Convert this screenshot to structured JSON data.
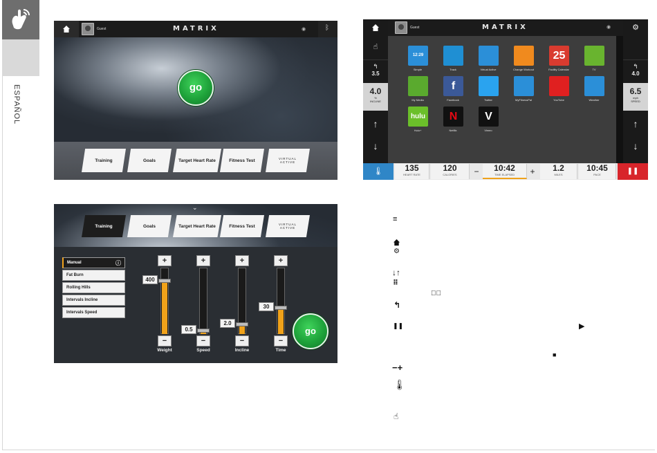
{
  "side": {
    "language": "ESPAÑOL"
  },
  "screen1": {
    "guest": "Guest",
    "logo": "MATRIX",
    "go": "go",
    "menu": [
      "Training",
      "Goals",
      "Target Heart Rate",
      "Fitness Test"
    ],
    "virtual_active_line1": "VIRTUAL",
    "virtual_active_line2": "ACTIVE"
  },
  "screen2": {
    "guest": "Guest",
    "logo": "MATRIX",
    "apps": [
      "Simple",
      "Track",
      "Virtual Active",
      "Change Workout",
      "Facility Calendar",
      "TV",
      "My Media",
      "Facebook",
      "Twitter",
      "MyFitnessPal",
      "YouTube",
      "Weather",
      "Hulu+",
      "Netflix",
      "Vimeo"
    ],
    "app_glyphs": {
      "simple": "12:29",
      "calendar": "25",
      "facebook": "f",
      "hulu": "hulu",
      "netflix": "N",
      "vimeo": "V"
    },
    "left": {
      "back_value": "3.5",
      "incline_value": "4.0",
      "incline_unit": "%",
      "incline_label": "INCLINE"
    },
    "right": {
      "back_value": "4.0",
      "speed_value": "6.5",
      "speed_unit": "mph",
      "speed_label": "SPEED"
    },
    "stats": [
      {
        "value": "135",
        "label": "HEART RATE"
      },
      {
        "value": "120",
        "label": "CALORIES"
      },
      {
        "value": "10:42",
        "label": "TIME ELAPSED"
      },
      {
        "value": "1.2",
        "label": "MILES"
      },
      {
        "value": "10:45",
        "label": "PACE"
      }
    ],
    "minus": "−",
    "plus": "+"
  },
  "screen3": {
    "menu": [
      "Training",
      "Goals",
      "Target Heart Rate",
      "Fitness Test"
    ],
    "virtual_active_line1": "VIRTUAL",
    "virtual_active_line2": "ACTIVE",
    "programs": [
      "Manual",
      "Fat Burn",
      "Rolling Hills",
      "Intervals Incline",
      "Intervals Speed"
    ],
    "sliders": [
      {
        "label": "Weight",
        "value": "400",
        "level": 0.8
      },
      {
        "label": "Speed",
        "value": "0.5",
        "level": 0.05
      },
      {
        "label": "Incline",
        "value": "2.0",
        "level": 0.15
      },
      {
        "label": "Time",
        "value": "30",
        "level": 0.4
      }
    ],
    "plus": "+",
    "minus": "−",
    "go": "go"
  },
  "legend": {
    "icons": [
      "menu-icon",
      "home-icon",
      "gear-icon",
      "down-up-arrows-icon",
      "grid-icon",
      "check-circle-icon",
      "back-icon",
      "pause-icon",
      "play-icon",
      "stop-icon",
      "minus-plus-icon",
      "thermometer-icon",
      "touch-icon"
    ]
  }
}
